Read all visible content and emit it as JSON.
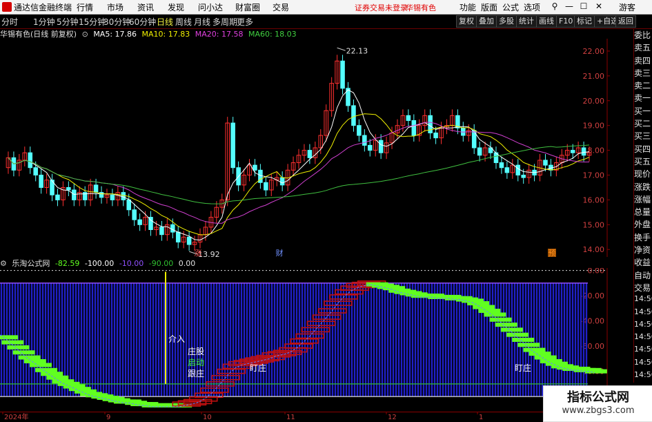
{
  "menubar": {
    "app_title": "通达信金融终端",
    "items": [
      "行情",
      "市场",
      "资讯",
      "发现",
      "问小达",
      "财富圈",
      "交易"
    ],
    "warning": "证券交易未登录",
    "stock_name": "华锡有色",
    "right_items": [
      "功能",
      "版面",
      "公式",
      "选项"
    ],
    "guest": "游客",
    "window_buttons": [
      "⚲",
      "—",
      "☐",
      "✕"
    ]
  },
  "toolbar": {
    "periods": [
      "分时",
      "1分钟",
      "5分钟",
      "15分钟",
      "30分钟",
      "60分钟",
      "日线",
      "周线",
      "月线",
      "多周期",
      "更多"
    ],
    "active_period": "日线",
    "right_buttons": [
      "复权",
      "叠加",
      "多股",
      "统计",
      "画线",
      "F10",
      "标记",
      "+自选",
      "返回"
    ]
  },
  "main_chart": {
    "title": "华锡有色(日线 前复权)",
    "ma5_label": "MA5: 17.86",
    "ma10_label": "MA10: 17.83",
    "ma20_label": "MA20: 17.58",
    "ma60_label": "MA60: 18.03",
    "high_label": "22.13",
    "low_label": "13.92",
    "markers": [
      "涨",
      "财",
      "预"
    ]
  },
  "indicator": {
    "title": "乐淘公式网",
    "values": [
      "-82.59",
      "-100.00",
      "-10.00",
      "-90.00",
      "0.00"
    ],
    "labels": {
      "entry": "介入",
      "l1": "庄股",
      "l2": "启动",
      "l3": "跟庄",
      "watch1": "盯庄",
      "watch2": "盯庄"
    }
  },
  "xaxis": {
    "labels": [
      "2024年",
      "9",
      "10",
      "11",
      "12",
      "1"
    ]
  },
  "right_panel": {
    "items": [
      "委比",
      "卖五",
      "卖四",
      "卖三",
      "卖二",
      "卖一",
      "买一",
      "买二",
      "买三",
      "买四",
      "买五",
      "现价",
      "涨跌",
      "涨幅",
      "总量",
      "外盘",
      "换手",
      "净资",
      "收益",
      "自动",
      "交易",
      "14:56",
      "14:56",
      "14:56",
      "14:56",
      "14:56",
      "14:56",
      "14:56"
    ]
  },
  "watermark": {
    "line1": "指标公式网",
    "line2": "www.zbgs3.com"
  },
  "chart_data": [
    {
      "type": "candlestick",
      "title": "华锡有色(日线 前复权)",
      "y_axis_ticks": [
        22.0,
        21.0,
        20.0,
        19.0,
        18.0,
        17.0,
        16.0,
        15.0,
        14.0
      ],
      "ylim": [
        13.7,
        22.5
      ],
      "x_axis_labels": [
        "2024年",
        "9",
        "10",
        "11",
        "12",
        "1"
      ],
      "close": [
        17.7,
        17.2,
        17.6,
        17.9,
        17.3,
        17.0,
        16.5,
        16.8,
        16.2,
        16.0,
        16.5,
        16.4,
        16.0,
        16.3,
        16.0,
        16.6,
        16.3,
        16.1,
        16.2,
        16.0,
        16.3,
        16.0,
        15.6,
        15.2,
        15.0,
        15.3,
        14.8,
        14.9,
        14.6,
        15.0,
        14.7,
        14.3,
        14.5,
        14.2,
        14.3,
        14.6,
        14.9,
        15.3,
        15.7,
        16.0,
        19.1,
        17.3,
        16.6,
        17.0,
        17.4,
        17.2,
        16.7,
        16.4,
        16.8,
        16.9,
        16.6,
        17.2,
        17.5,
        17.8,
        18.0,
        17.7,
        18.1,
        18.6,
        19.6,
        20.7,
        21.6,
        20.5,
        19.8,
        19.0,
        18.6,
        18.2,
        18.0,
        18.4,
        17.9,
        18.3,
        18.7,
        19.0,
        19.4,
        19.2,
        18.6,
        19.0,
        19.4,
        18.7,
        18.5,
        18.9,
        19.0,
        19.4,
        18.9,
        18.6,
        18.8,
        18.1,
        17.8,
        18.1,
        17.9,
        17.5,
        17.3,
        17.1,
        17.4,
        17.0,
        16.9,
        17.2,
        17.0,
        17.6,
        17.4,
        17.2,
        17.5,
        17.8,
        18.0,
        17.9,
        18.1,
        17.8,
        17.9
      ],
      "open": [
        17.3,
        17.7,
        17.2,
        17.6,
        17.9,
        17.3,
        17.0,
        16.5,
        16.8,
        16.2,
        16.0,
        16.5,
        16.4,
        16.0,
        16.3,
        16.0,
        16.6,
        16.3,
        16.1,
        16.2,
        16.0,
        16.3,
        16.0,
        15.6,
        15.2,
        15.0,
        15.3,
        14.8,
        14.9,
        14.6,
        15.0,
        14.7,
        14.3,
        14.5,
        14.2,
        14.3,
        14.6,
        14.9,
        15.3,
        15.7,
        16.0,
        19.1,
        17.3,
        16.6,
        17.0,
        17.4,
        17.2,
        16.7,
        16.4,
        16.8,
        16.9,
        16.6,
        17.2,
        17.5,
        17.8,
        18.0,
        17.7,
        18.1,
        18.6,
        19.6,
        20.7,
        21.6,
        20.5,
        19.8,
        19.0,
        18.6,
        18.2,
        18.0,
        18.4,
        17.9,
        18.3,
        18.7,
        19.0,
        19.4,
        19.2,
        18.6,
        19.0,
        19.4,
        18.7,
        18.5,
        18.9,
        19.0,
        19.4,
        18.9,
        18.6,
        18.8,
        18.1,
        17.8,
        18.1,
        17.9,
        17.5,
        17.3,
        17.1,
        17.4,
        17.0,
        16.9,
        17.2,
        17.0,
        17.6,
        17.4,
        17.2,
        17.5,
        17.8,
        18.0,
        17.9,
        18.1,
        17.8
      ],
      "high_marker": 22.13,
      "low_marker": 13.92,
      "series": [
        {
          "name": "MA5",
          "color": "#ffffff"
        },
        {
          "name": "MA10",
          "color": "#f0f000"
        },
        {
          "name": "MA20",
          "color": "#d040d0"
        },
        {
          "name": "MA60",
          "color": "#40c040"
        }
      ],
      "colors": {
        "up": "#ff3030",
        "down": "#54ffff"
      }
    },
    {
      "type": "indicator",
      "title": "乐淘公式网",
      "y_axis_ticks": [
        0.0,
        -20.0,
        -40.0,
        -60.0,
        -80.0
      ],
      "ylim": [
        -112,
        2
      ],
      "main_line": [
        -50,
        -53,
        -57,
        -61,
        -65,
        -69,
        -72,
        -75,
        -79,
        -82,
        -85,
        -88,
        -90,
        -92,
        -94,
        -96,
        -98,
        -99,
        -100,
        -101,
        -102,
        -103,
        -104,
        -104,
        -105,
        -106,
        -106,
        -107,
        -107,
        -107,
        -107,
        -107,
        -107,
        -106,
        -105,
        -104,
        -102,
        -99,
        -95,
        -90,
        -85,
        -80,
        -76,
        -74,
        -73,
        -72,
        -71,
        -70,
        -69,
        -67,
        -66,
        -65,
        -63,
        -60,
        -56,
        -52,
        -47,
        -42,
        -37,
        -32,
        -26,
        -21,
        -17,
        -14,
        -12,
        -11,
        -10,
        -11,
        -12,
        -13,
        -14,
        -16,
        -17,
        -18,
        -19,
        -20,
        -20,
        -20,
        -21,
        -21,
        -21,
        -22,
        -22,
        -23,
        -24,
        -26,
        -29,
        -32,
        -35,
        -39,
        -43,
        -47,
        -51,
        -55,
        -59,
        -63,
        -66,
        -69,
        -72,
        -74,
        -76,
        -77,
        -78,
        -78,
        -79,
        -79,
        -80
      ],
      "reference_lines": [
        -10,
        -90,
        -100
      ],
      "colors": {
        "rising": "#c01010",
        "falling": "#60ff20",
        "bars": "#2020c8",
        "ref_top": "#9050ff",
        "ref_mid": "#30c030",
        "ref_low": "#e0e0e0"
      }
    }
  ]
}
